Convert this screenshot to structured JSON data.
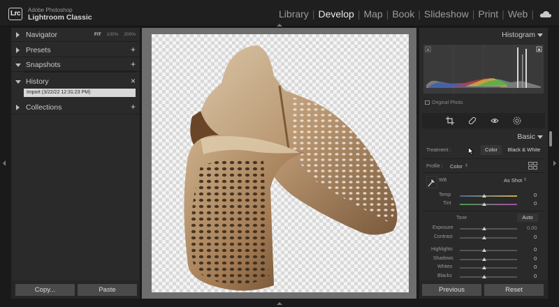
{
  "app": {
    "vendor": "Adobe Photoshop",
    "name": "Lightroom Classic",
    "badge": "Lrc"
  },
  "modules": [
    "Library",
    "Develop",
    "Map",
    "Book",
    "Slideshow",
    "Print",
    "Web"
  ],
  "active_module": "Develop",
  "left_panel": {
    "navigator": {
      "label": "Navigator",
      "zooms": [
        "FIT",
        "100%",
        "200%"
      ]
    },
    "presets": {
      "label": "Presets",
      "action": "+"
    },
    "snapshots": {
      "label": "Snapshots",
      "action": "+"
    },
    "history": {
      "label": "History",
      "action": "×",
      "items": [
        "Import (3/22/22 12:31:23 PM)"
      ]
    },
    "collections": {
      "label": "Collections",
      "action": "+"
    },
    "copy_button": "Copy...",
    "paste_button": "Paste"
  },
  "right_panel": {
    "histogram_label": "Histogram",
    "original_photo_label": "Original Photo",
    "basic_label": "Basic",
    "treatment": {
      "label": "Treatment :",
      "options": [
        "Color",
        "Black & White"
      ],
      "selected": "Color"
    },
    "profile": {
      "label": "Profile :",
      "value": "Color"
    },
    "wb": {
      "label": "WB",
      "value": "As Shot"
    },
    "temp": {
      "label": "Temp",
      "value": "0"
    },
    "tint": {
      "label": "Tint",
      "value": "0"
    },
    "tone_label": "Tone",
    "auto_button": "Auto",
    "exposure": {
      "label": "Exposure",
      "value": "0.00"
    },
    "contrast": {
      "label": "Contrast",
      "value": "0"
    },
    "highlights": {
      "label": "Highlights",
      "value": "0"
    },
    "shadows": {
      "label": "Shadows",
      "value": "0"
    },
    "whites": {
      "label": "Whites",
      "value": "0"
    },
    "blacks": {
      "label": "Blacks",
      "value": "0"
    },
    "previous_button": "Previous",
    "reset_button": "Reset"
  },
  "colors": {
    "accent_text": "#eaeaea",
    "panel_bg": "#2a2a2a",
    "history_selected_bg": "#d8d8d8"
  }
}
